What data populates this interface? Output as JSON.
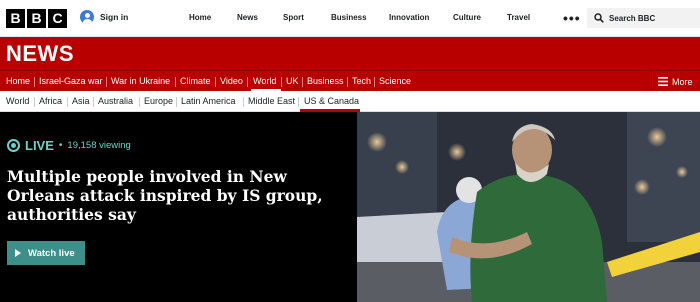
{
  "logo": {
    "letters": [
      "B",
      "B",
      "C"
    ]
  },
  "header": {
    "signin_label": "Sign in",
    "nav": [
      "Home",
      "News",
      "Sport",
      "Business",
      "Innovation",
      "Culture",
      "Travel"
    ],
    "more_icon": "ellipsis-icon",
    "search_placeholder": "Search BBC"
  },
  "news": {
    "title": "NEWS"
  },
  "sections": {
    "items": [
      "Home",
      "Israel-Gaza war",
      "War in Ukraine",
      "Climate",
      "Video",
      "World",
      "UK",
      "Business",
      "Tech",
      "Science"
    ],
    "active": "World",
    "more_label": "More"
  },
  "subnav": {
    "items": [
      "World",
      "Africa",
      "Asia",
      "Australia",
      "Europe",
      "Latin America",
      "Middle East",
      "US & Canada"
    ],
    "active": "US & Canada"
  },
  "hero": {
    "live_label": "LIVE",
    "separator": "•",
    "viewing": "19,158 viewing",
    "headline": "Multiple people involved in New Orleans attack inspired by IS group, authorities say",
    "watch_label": "Watch live"
  },
  "colors": {
    "brand_red": "#b80000",
    "live_teal": "#6fd2c7",
    "button_teal": "#3e8e89"
  }
}
